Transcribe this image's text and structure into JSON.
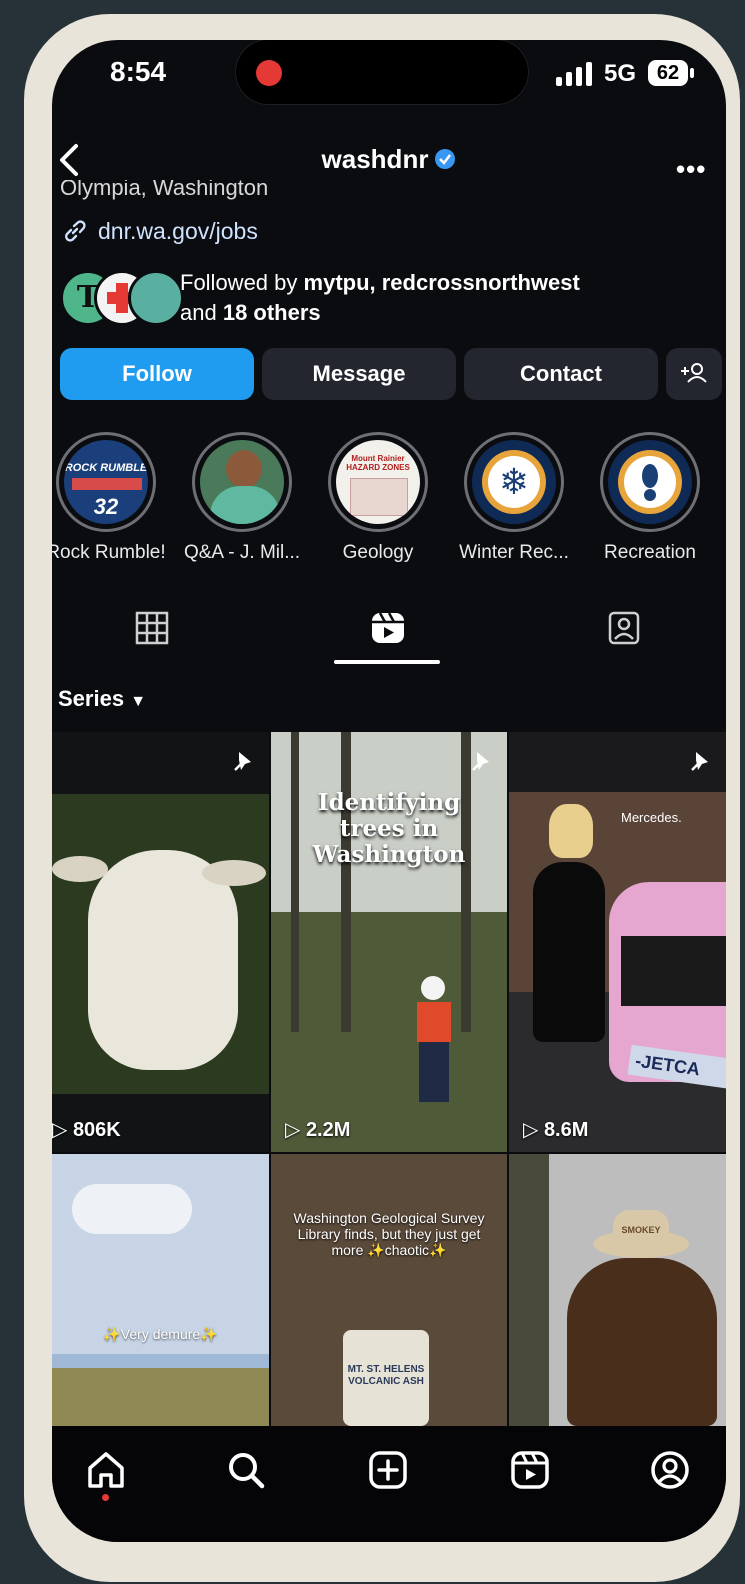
{
  "status_bar": {
    "time": "8:54",
    "network": "5G",
    "battery": "62"
  },
  "header": {
    "username": "washdnr",
    "more_label": "•••"
  },
  "profile": {
    "location": "Olympia, Washington",
    "link": "dnr.wa.gov/jobs",
    "followed_by": {
      "prefix": "Followed by ",
      "names": "mytpu, redcrossnorthwest",
      "middle": "and ",
      "others": "18 others"
    }
  },
  "actions": {
    "follow": "Follow",
    "message": "Message",
    "contact": "Contact"
  },
  "highlights": [
    {
      "label": "Rock Rumble!",
      "badge_top": "ROCK RUMBLE",
      "badge_num": "32"
    },
    {
      "label": "Q&A - J. Mil..."
    },
    {
      "label": "Geology",
      "thumb_text": "Mount Rainier HAZARD ZONES"
    },
    {
      "label": "Winter Rec..."
    },
    {
      "label": "Recreation"
    }
  ],
  "filter": {
    "label": "Series"
  },
  "reels": [
    {
      "views": "806K",
      "pinned": true
    },
    {
      "views": "2.2M",
      "pinned": true,
      "overlay": "Identifying trees in Washington"
    },
    {
      "views": "8.6M",
      "pinned": true,
      "overlay_small": "Mercedes.",
      "plate": "-JETCA"
    },
    {
      "views": "",
      "overlay": "✨Very demure✨"
    },
    {
      "views": "",
      "overlay": "Washington Geological Survey Library finds, but they just get more ✨chaotic✨",
      "can_text": "MT. ST. HELENS VOLCANIC ASH"
    },
    {
      "views": "",
      "hat_text": "SMOKEY"
    }
  ],
  "colors": {
    "accent": "#1f9bf0",
    "background": "#0b0c10",
    "button": "#23262e"
  }
}
